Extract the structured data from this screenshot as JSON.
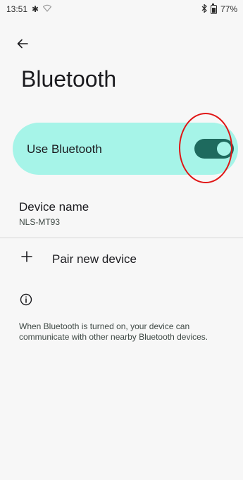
{
  "status_bar": {
    "time": "13:51",
    "gear_icon": "settings-gear-icon",
    "wifi_icon": "wifi-icon",
    "bluetooth_icon": "bluetooth-icon",
    "battery_level": "77%"
  },
  "header": {
    "back_icon": "arrow-left-icon",
    "title": "Bluetooth"
  },
  "main_toggle": {
    "label": "Use Bluetooth",
    "checked": true,
    "accent_bg": "#a6f4e8",
    "switch_color": "#1e6a5e"
  },
  "device_name": {
    "title": "Device name",
    "value": "NLS-MT93"
  },
  "pair": {
    "label": "Pair new device",
    "icon": "plus-icon"
  },
  "info": {
    "icon": "info-icon",
    "text": "When Bluetooth is turned on, your device can communicate with other nearby Bluetooth devices."
  },
  "annotation": {
    "color": "#e01616"
  }
}
